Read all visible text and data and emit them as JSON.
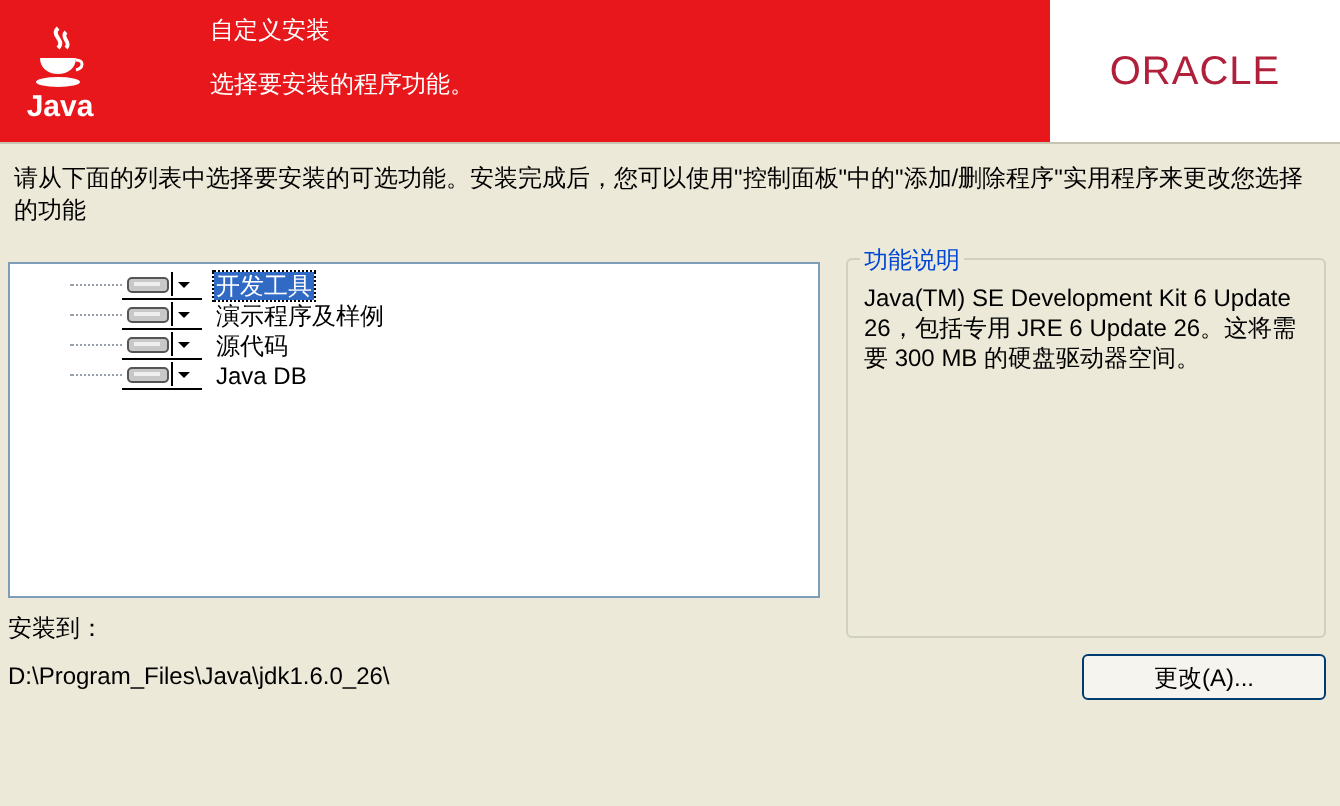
{
  "header": {
    "logo_text": "Java",
    "title": "自定义安装",
    "subtitle": "选择要安装的程序功能。",
    "brand": "ORACLE"
  },
  "instructions": "请从下面的列表中选择要安装的可选功能。安装完成后，您可以使用\"控制面板\"中的\"添加/删除程序\"实用程序来更改您选择的功能",
  "features": [
    {
      "label": "开发工具",
      "selected": true
    },
    {
      "label": "演示程序及样例",
      "selected": false
    },
    {
      "label": "源代码",
      "selected": false
    },
    {
      "label": "Java DB",
      "selected": false
    }
  ],
  "description": {
    "title": "功能说明",
    "text": "Java(TM) SE Development Kit 6 Update 26，包括专用 JRE 6 Update 26。这将需要 300 MB 的硬盘驱动器空间。"
  },
  "install_to": {
    "label": "安装到：",
    "path": "D:\\Program_Files\\Java\\jdk1.6.0_26\\"
  },
  "buttons": [
    {
      "label": "更改(A)..."
    }
  ]
}
